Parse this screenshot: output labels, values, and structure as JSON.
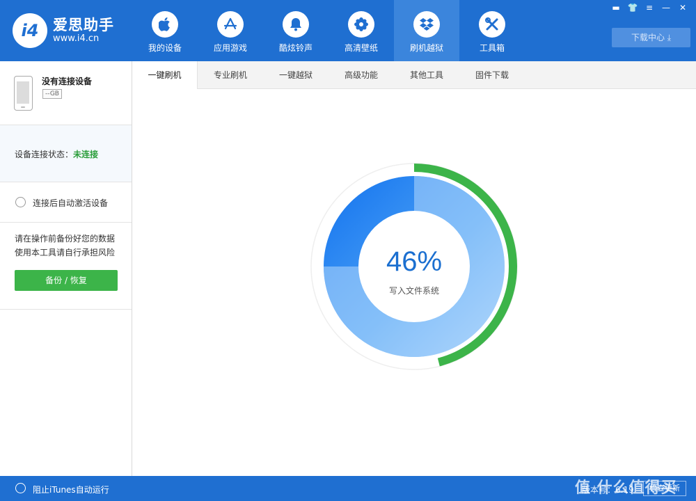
{
  "app": {
    "logo_mark": "i4",
    "logo_name": "爱思助手",
    "logo_url": "www.i4.cn"
  },
  "nav": {
    "items": [
      {
        "label": "我的设备",
        "icon": "apple-icon",
        "glyph": ""
      },
      {
        "label": "应用游戏",
        "icon": "app-store-icon",
        "glyph": "A"
      },
      {
        "label": "酷炫铃声",
        "icon": "bell-icon",
        "glyph": "🔔"
      },
      {
        "label": "高清壁纸",
        "icon": "flower-icon",
        "glyph": "❀"
      },
      {
        "label": "刷机越狱",
        "icon": "dropbox-icon",
        "glyph": "◈"
      },
      {
        "label": "工具箱",
        "icon": "tools-icon",
        "glyph": "✕"
      }
    ],
    "active_index": 4
  },
  "window_controls": [
    "▬",
    "👕",
    "≡",
    "—",
    "✕"
  ],
  "download_center": "下载中心 ⤓",
  "sidebar": {
    "device_name": "没有连接设备",
    "device_capacity": "--GB",
    "status_label": "设备连接状态：",
    "status_value": "未连接",
    "auto_activate": "连接后自动激活设备",
    "warning_line1": "请在操作前备份好您的数据",
    "warning_line2": "使用本工具请自行承担风险",
    "backup_button": "备份 / 恢复"
  },
  "tabs": [
    "一键刷机",
    "专业刷机",
    "一键越狱",
    "高级功能",
    "其他工具",
    "固件下载"
  ],
  "active_tab": 0,
  "progress": {
    "value": 0.46,
    "percent_text": "46%",
    "caption": "写入文件系统"
  },
  "colors": {
    "brand": "#1f6fd1",
    "progress": "#3cb449",
    "ring_dark": "#1b7df0",
    "ring_light": "#a7d0fa"
  },
  "bottom": {
    "itunes_label": "阻止iTunes自动运行",
    "version": "版本号：6.19",
    "check_update": "检查更新",
    "watermark": "值 什么值得买"
  }
}
